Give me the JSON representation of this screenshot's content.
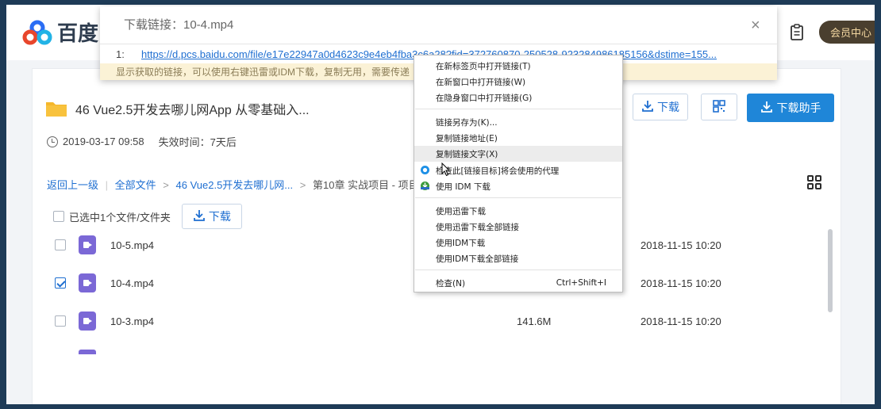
{
  "header": {
    "logo_text": "百度",
    "vip_label": "会员中心"
  },
  "dialog": {
    "title": "下载链接：10-4.mp4",
    "close_glyph": "×",
    "link_index": "1:",
    "link_url": "https://d.pcs.baidu.com/file/e17e22947a0d4623c9e4eb4fba3c6a28?fid=372760870-250528-923284986185156&dstime=155...",
    "tip": "显示获取的链接，可以使用右键迅雷或IDM下载，复制无用，需要传递"
  },
  "folder": {
    "title": "46 Vue2.5开发去哪儿网App 从零基础入...",
    "date": "2019-03-17 09:58",
    "expire_label": "失效时间：7天后",
    "download_label": "下载",
    "download_helper_label": "下载助手"
  },
  "breadcrumb": {
    "back": "返回上一级",
    "all_files": "全部文件",
    "sep": ">",
    "folder": "46 Vue2.5开发去哪儿网...",
    "current": "第10章 实战项目 - 项目的"
  },
  "selection": {
    "label": "已选中1个文件/文件夹",
    "download_label": "下载"
  },
  "files": [
    {
      "name": "10-5.mp4",
      "size": "",
      "date": "2018-11-15 10:20",
      "checked": false
    },
    {
      "name": "10-4.mp4",
      "size": "",
      "date": "2018-11-15 10:20",
      "checked": true
    },
    {
      "name": "10-3.mp4",
      "size": "141.6M",
      "date": "2018-11-15 10:20",
      "checked": false
    }
  ],
  "context_menu": {
    "items": [
      {
        "label": "在新标签页中打开链接(T)"
      },
      {
        "label": "在新窗口中打开链接(W)"
      },
      {
        "label": "在隐身窗口中打开链接(G)"
      },
      {
        "label": "链接另存为(K)..."
      },
      {
        "label": "复制链接地址(E)"
      },
      {
        "label": "复制链接文字(X)"
      },
      {
        "label": "检查此[链接目标]将会使用的代理",
        "icon": "proxy-icon"
      },
      {
        "label": "使用 IDM 下载",
        "icon": "idm-icon"
      },
      {
        "label": "使用迅雷下载"
      },
      {
        "label": "使用迅雷下载全部链接"
      },
      {
        "label": "使用IDM下载"
      },
      {
        "label": "使用IDM下载全部链接"
      },
      {
        "label": "检查(N)",
        "shortcut": "Ctrl+Shift+I"
      }
    ]
  }
}
